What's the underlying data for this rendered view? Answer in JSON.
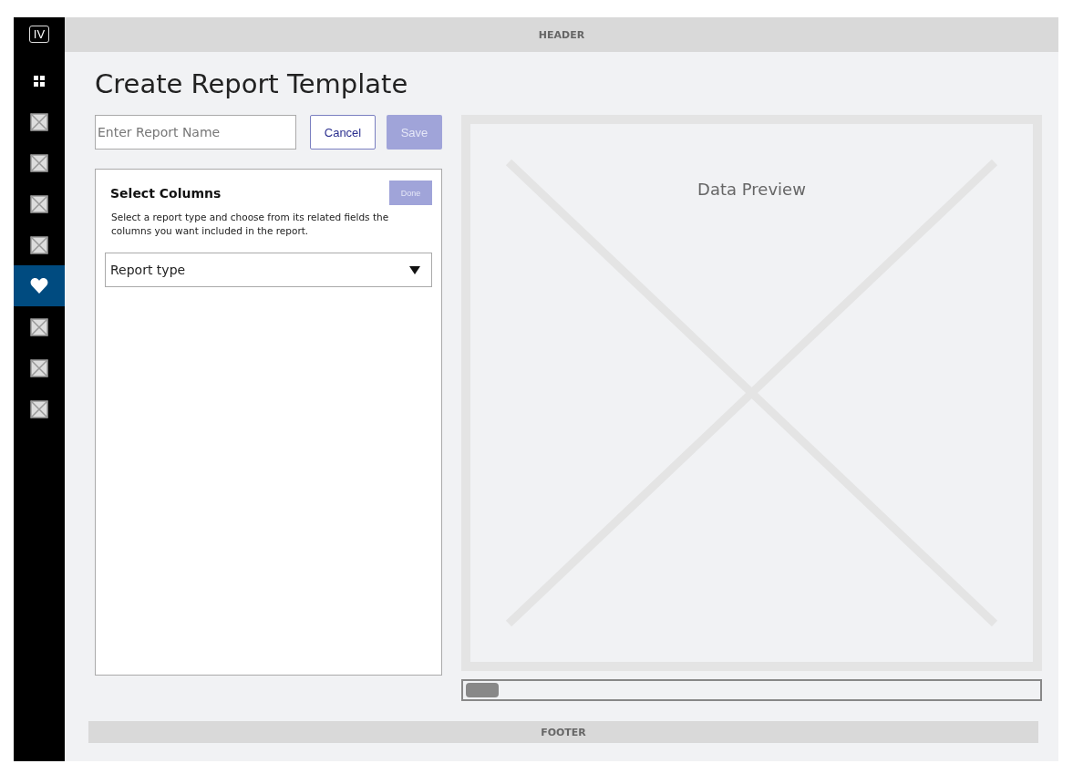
{
  "sidebar": {
    "logo": "IV",
    "items": [
      {
        "kind": "grid",
        "selected": false
      },
      {
        "kind": "placeholder",
        "selected": false
      },
      {
        "kind": "placeholder",
        "selected": false
      },
      {
        "kind": "placeholder",
        "selected": false
      },
      {
        "kind": "placeholder",
        "selected": false
      },
      {
        "kind": "heart",
        "selected": true
      },
      {
        "kind": "placeholder",
        "selected": false
      },
      {
        "kind": "placeholder",
        "selected": false
      },
      {
        "kind": "placeholder",
        "selected": false
      }
    ]
  },
  "header": "HEADER",
  "title": "Create Report Template",
  "report_name": {
    "placeholder": "Enter Report Name"
  },
  "buttons": {
    "cancel": "Cancel",
    "save": "Save"
  },
  "select_columns": {
    "title": "Select Columns",
    "done": "Done",
    "description": "Select a report type and choose from its related fields the columns you want included in the report.",
    "report_type": "Report type"
  },
  "preview": {
    "label": "Data Preview"
  },
  "footer": "FOOTER"
}
